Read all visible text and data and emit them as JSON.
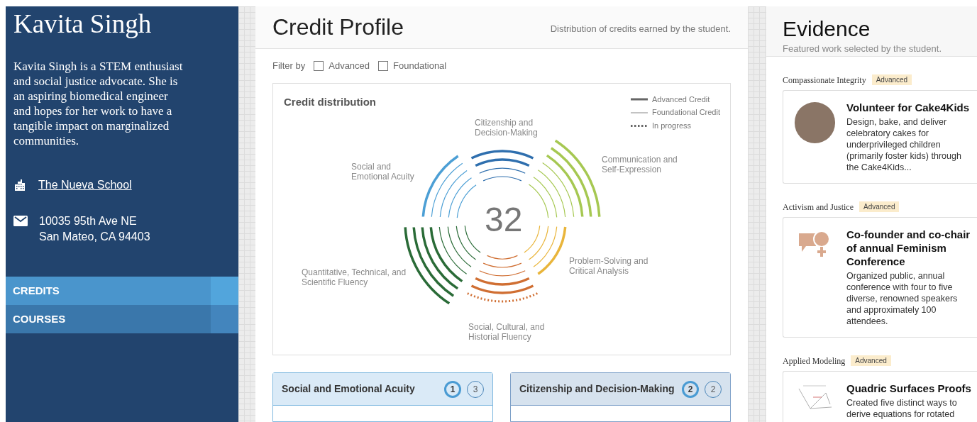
{
  "profile": {
    "name": "Kavita Singh",
    "bio": "Kavita Singh is a STEM enthusiast and social justice advocate. She is an aspiring biomedical engineer and hopes for her work to have a tangible impact on marginalized communities.",
    "school": "The Nueva School",
    "address_lines": [
      "10035 95th Ave NE",
      "San Mateo, CA 94403"
    ]
  },
  "nav": [
    {
      "label": "CREDITS",
      "selected": true
    },
    {
      "label": "COURSES",
      "selected": false
    }
  ],
  "credit_profile": {
    "title": "Credit Profile",
    "subtitle": "Distribution of credits earned by the student.",
    "filter": {
      "label": "Filter by",
      "options": [
        {
          "label": "Advanced",
          "checked": false
        },
        {
          "label": "Foundational",
          "checked": false
        }
      ]
    },
    "chart": {
      "title": "Credit distribution",
      "total": "32",
      "legend": [
        {
          "label": "Advanced Credit",
          "kind": "thick"
        },
        {
          "label": "Foundational Credit",
          "kind": "thin"
        },
        {
          "label": "In progress",
          "kind": "dotted"
        }
      ],
      "labels": [
        "Citizenship and Decision-Making",
        "Communication and Self-Expression",
        "Social and Emotional Acuity",
        "Problem-Solving and Critical Analysis",
        "Quantitative, Technical, and Scientific Fluency",
        "Social, Cultural, and Historial Fluency"
      ]
    },
    "category_cards": [
      {
        "title": "Social and Emotional Acuity",
        "advanced_count": "1",
        "foundational_count": "3",
        "selected": true
      },
      {
        "title": "Citizenship and Decision-Making",
        "advanced_count": "2",
        "foundational_count": "2",
        "selected": false
      }
    ]
  },
  "evidence": {
    "title": "Evidence",
    "subtitle": "Featured work selected by the student.",
    "items": [
      {
        "category": "Compassionate Integrity",
        "badge": "Advanced",
        "kind": "photo",
        "title": "Volunteer for Cake4Kids",
        "description": "Design, bake, and deliver celebratory cakes for underprivileged children (primarily foster kids) through the Cake4Kids..."
      },
      {
        "category": "Activism and Justice",
        "badge": "Advanced",
        "kind": "logo",
        "title": "Co-founder and co-chair of annual Feminism Conference",
        "description": "Organized public, annual conference with four to five diverse, renowned speakers and approximately 100 attendees."
      },
      {
        "category": "Applied Modeling",
        "badge": "Advanced",
        "kind": "graph",
        "title": "Quadric Surfaces Proofs",
        "description": "Created five distinct ways to derive equations for rotated"
      }
    ]
  }
}
